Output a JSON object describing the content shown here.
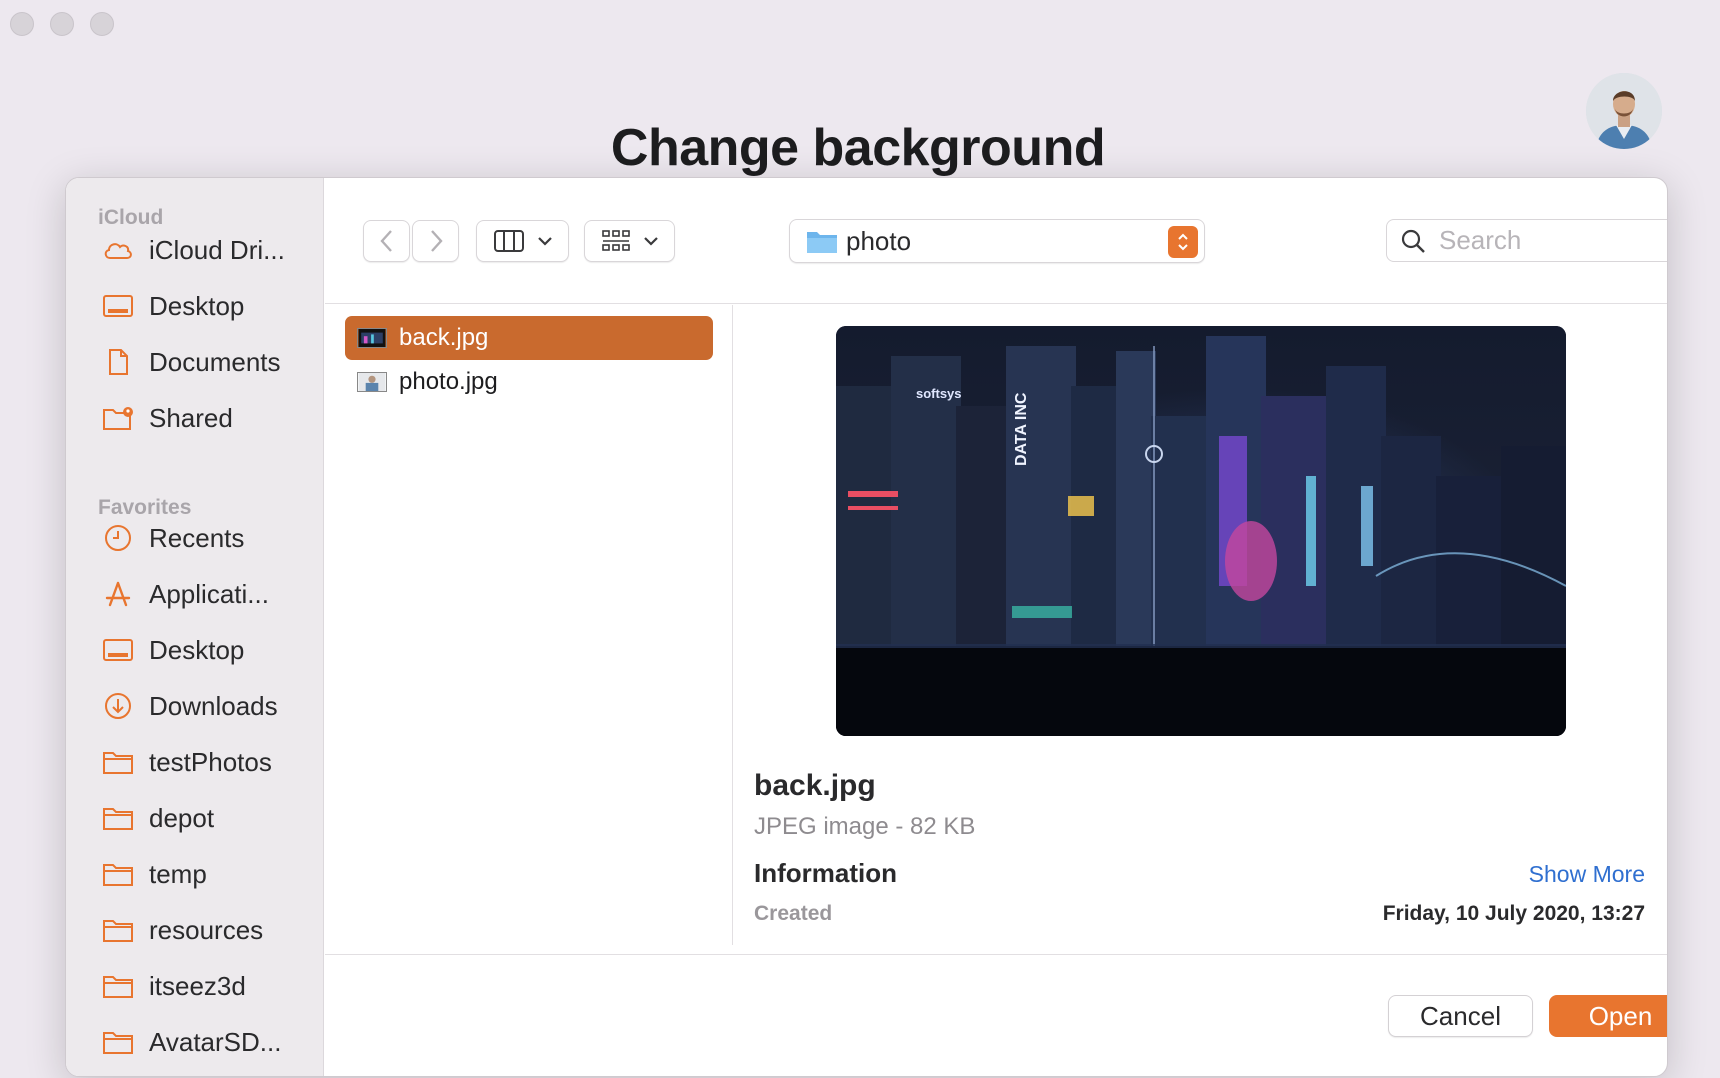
{
  "page": {
    "title": "Change background"
  },
  "sidebar": {
    "sections": [
      {
        "header": "iCloud",
        "items": [
          {
            "label": "iCloud Dri...",
            "icon": "cloud-icon"
          },
          {
            "label": "Desktop",
            "icon": "desktop-icon"
          },
          {
            "label": "Documents",
            "icon": "document-icon"
          },
          {
            "label": "Shared",
            "icon": "shared-folder-icon"
          }
        ]
      },
      {
        "header": "Favorites",
        "items": [
          {
            "label": "Recents",
            "icon": "clock-icon"
          },
          {
            "label": "Applicati...",
            "icon": "applications-icon"
          },
          {
            "label": "Desktop",
            "icon": "desktop-icon"
          },
          {
            "label": "Downloads",
            "icon": "download-icon"
          },
          {
            "label": "testPhotos",
            "icon": "folder-icon"
          },
          {
            "label": "depot",
            "icon": "folder-icon"
          },
          {
            "label": "temp",
            "icon": "folder-icon"
          },
          {
            "label": "resources",
            "icon": "folder-icon"
          },
          {
            "label": "itseez3d",
            "icon": "folder-icon"
          },
          {
            "label": "AvatarSD...",
            "icon": "folder-icon"
          }
        ]
      }
    ]
  },
  "toolbar": {
    "path": "photo",
    "search_placeholder": "Search"
  },
  "files": [
    {
      "name": "back.jpg",
      "selected": true
    },
    {
      "name": "photo.jpg",
      "selected": false
    }
  ],
  "preview": {
    "name": "back.jpg",
    "type": "JPEG image - 82 KB",
    "info_header": "Information",
    "show_more": "Show More",
    "created_label": "Created",
    "created_value": "Friday, 10 July 2020, 13:27",
    "image_text_1": "softsys",
    "image_text_2": "DATA INC"
  },
  "buttons": {
    "cancel": "Cancel",
    "open": "Open"
  },
  "colors": {
    "accent": "#e8752f",
    "selection": "#c96a2e",
    "link": "#2f6fd0"
  }
}
